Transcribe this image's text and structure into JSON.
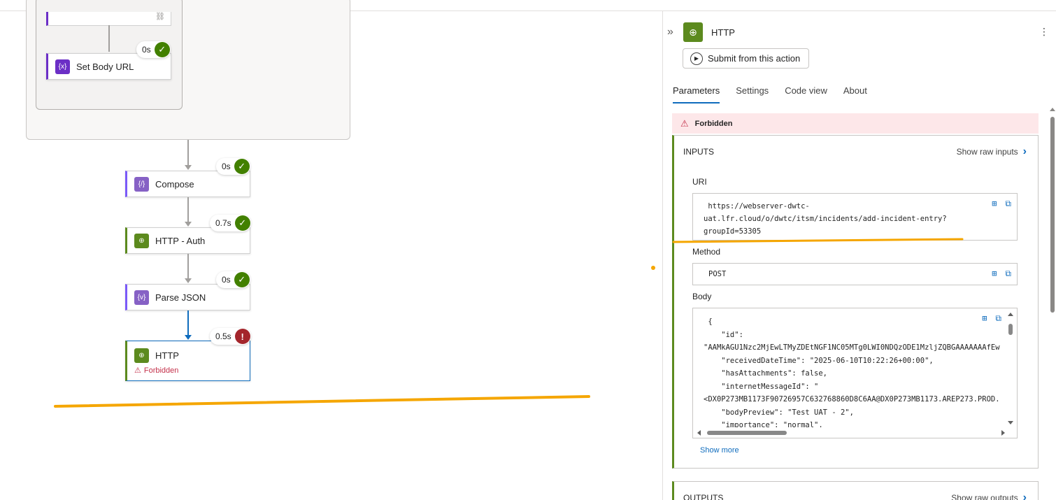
{
  "canvas": {
    "nodes": [
      {
        "label": "Set Body URL",
        "icon": "variable-icon",
        "duration": "0s",
        "status": "success"
      },
      {
        "label": "Compose",
        "icon": "compose-icon",
        "duration": "0s",
        "status": "success"
      },
      {
        "label": "HTTP - Auth",
        "icon": "http-globe-icon",
        "duration": "0.7s",
        "status": "success"
      },
      {
        "label": "Parse JSON",
        "icon": "parse-json-icon",
        "duration": "0s",
        "status": "success"
      },
      {
        "label": "HTTP",
        "icon": "http-globe-icon",
        "duration": "0.5s",
        "status": "error",
        "error": "Forbidden"
      }
    ],
    "highlight_color": "#f5a600"
  },
  "panel": {
    "title": "HTTP",
    "submit_label": "Submit from this action",
    "tabs": [
      "Parameters",
      "Settings",
      "Code view",
      "About"
    ],
    "active_tab": "Parameters",
    "error_text": "Forbidden",
    "inputs": {
      "heading": "INPUTS",
      "raw_link": "Show raw inputs",
      "uri_label": "URI",
      "uri_value": " https://webserver-dwtc-\nuat.lfr.cloud/o/dwtc/itsm/incidents/add-incident-entry?\ngroupId=53305",
      "method_label": "Method",
      "method_value": "POST",
      "body_label": "Body",
      "body_value": " {\n    \"id\":\n\"AAMkAGU1Nzc2MjEwLTMyZDEtNGF1NC05MTg0LWI0NDQzODE1MzljZQBGAAAAAAAfEw\n    \"receivedDateTime\": \"2025-06-10T10:22:26+00:00\",\n    \"hasAttachments\": false,\n    \"internetMessageId\": \"\n<DX0P273MB1173F90726957C632768860D8C6AA@DX0P273MB1173.AREP273.PROD.\n    \"bodyPreview\": \"Test UAT - 2\",\n    \"importance\": \"normal\",",
      "show_more": "Show more"
    },
    "outputs": {
      "heading": "OUTPUTS",
      "raw_link": "Show raw outputs"
    },
    "colors": {
      "accent": "#0f6cbd",
      "success": "#428000",
      "error": "#a4262c",
      "http": "#5c8a1e",
      "data_op": "#8661c5"
    }
  }
}
